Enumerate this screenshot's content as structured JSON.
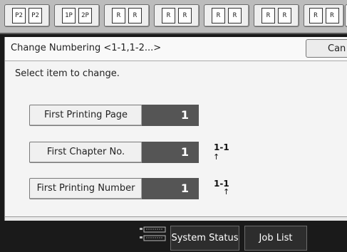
{
  "toolbar": {
    "buttons": [
      {
        "name": "pattern-p2-p2-icon",
        "glyphs": [
          "P2",
          "P2"
        ]
      },
      {
        "name": "pattern-p1-p2-icon",
        "glyphs": [
          "1P",
          "2P"
        ]
      },
      {
        "name": "pattern-rb-rb-icon",
        "glyphs": [
          "R",
          "R"
        ]
      },
      {
        "name": "pattern-r-r-icon",
        "glyphs": [
          "R",
          "R"
        ]
      },
      {
        "name": "pattern-r-rl-icon",
        "glyphs": [
          "R",
          "R"
        ]
      },
      {
        "name": "pattern-rt-rt-icon",
        "glyphs": [
          "R",
          "R"
        ]
      },
      {
        "name": "pattern-rr-rr-icon",
        "glyphs": [
          "R",
          "R"
        ]
      },
      {
        "name": "pattern-partial-icon",
        "glyphs": [
          "R"
        ]
      }
    ]
  },
  "dialog": {
    "title": "Change Numbering <1-1,1-2...>",
    "cancel_label": "Can",
    "instruction": "Select item to change."
  },
  "items": [
    {
      "label": "First Printing Page",
      "value": "1",
      "mark": "",
      "arrow": ""
    },
    {
      "label": "First Chapter No.",
      "value": "1",
      "mark": "1-1",
      "arrow": "↑"
    },
    {
      "label": "First Printing Number",
      "value": "1",
      "mark": "1-1",
      "arrow": "↑"
    }
  ],
  "footer": {
    "system_status_label": "System Status",
    "job_list_label": "Job List"
  }
}
